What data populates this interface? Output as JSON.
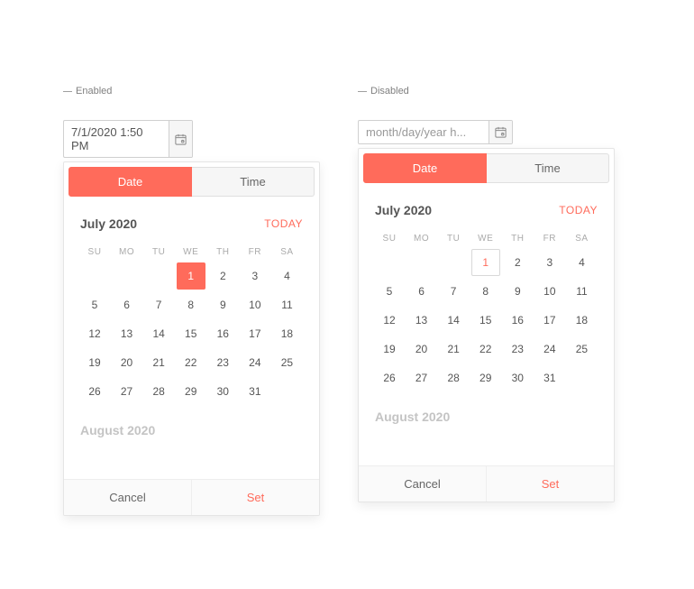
{
  "labels": {
    "enabled": "Enabled",
    "disabled": "Disabled"
  },
  "datepicker": {
    "enabled": {
      "input_value": "7/1/2020 1:50 PM"
    },
    "disabled": {
      "input_placeholder": "month/day/year h..."
    },
    "tabs": {
      "date": "Date",
      "time": "Time"
    },
    "today_label": "TODAY",
    "month_title": "July 2020",
    "next_month_title": "August 2020",
    "weekdays": [
      "SU",
      "MO",
      "TU",
      "WE",
      "TH",
      "FR",
      "SA"
    ],
    "selected_day": "1",
    "days": {
      "r1": [
        "",
        "",
        "",
        "1",
        "2",
        "3",
        "4"
      ],
      "r2": [
        "5",
        "6",
        "7",
        "8",
        "9",
        "10",
        "11"
      ],
      "r3": [
        "12",
        "13",
        "14",
        "15",
        "16",
        "17",
        "18"
      ],
      "r4": [
        "19",
        "20",
        "21",
        "22",
        "23",
        "24",
        "25"
      ],
      "r5": [
        "26",
        "27",
        "28",
        "29",
        "30",
        "31",
        ""
      ]
    },
    "footer": {
      "cancel": "Cancel",
      "set": "Set"
    }
  },
  "colors": {
    "accent": "#ff6b5b"
  },
  "icons": {
    "calendar": "calendar-icon"
  }
}
